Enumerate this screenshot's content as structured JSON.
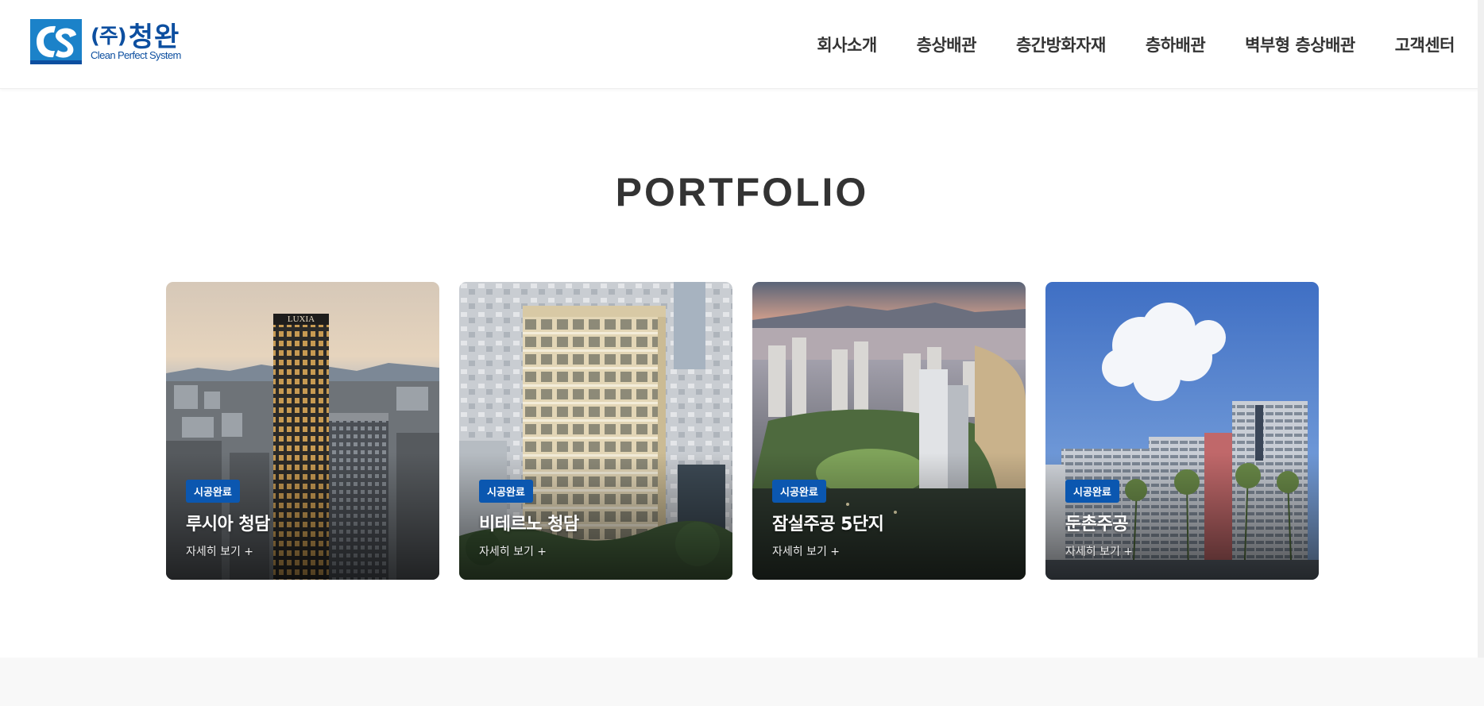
{
  "logo": {
    "company_paren": "(주)",
    "company_name": "청완",
    "tagline": "Clean Perfect System"
  },
  "nav": {
    "items": [
      {
        "label": "회사소개"
      },
      {
        "label": "층상배관"
      },
      {
        "label": "층간방화자재"
      },
      {
        "label": "층하배관"
      },
      {
        "label": "벽부형 층상배관"
      },
      {
        "label": "고객센터"
      }
    ]
  },
  "portfolio": {
    "title": "PORTFOLIO",
    "cards": [
      {
        "badge": "시공완료",
        "title": "루시아 청담",
        "more": "자세히 보기 +",
        "sign": "LUXIA"
      },
      {
        "badge": "시공완료",
        "title": "비테르노 청담",
        "more": "자세히 보기 +"
      },
      {
        "badge": "시공완료",
        "title": "잠실주공 5단지",
        "more": "자세히 보기 +"
      },
      {
        "badge": "시공완료",
        "title": "둔촌주공",
        "more": "자세히 보기 +"
      }
    ]
  },
  "colors": {
    "brand": "#0d4fa0",
    "badge": "#0b57b0",
    "text": "#333333"
  }
}
